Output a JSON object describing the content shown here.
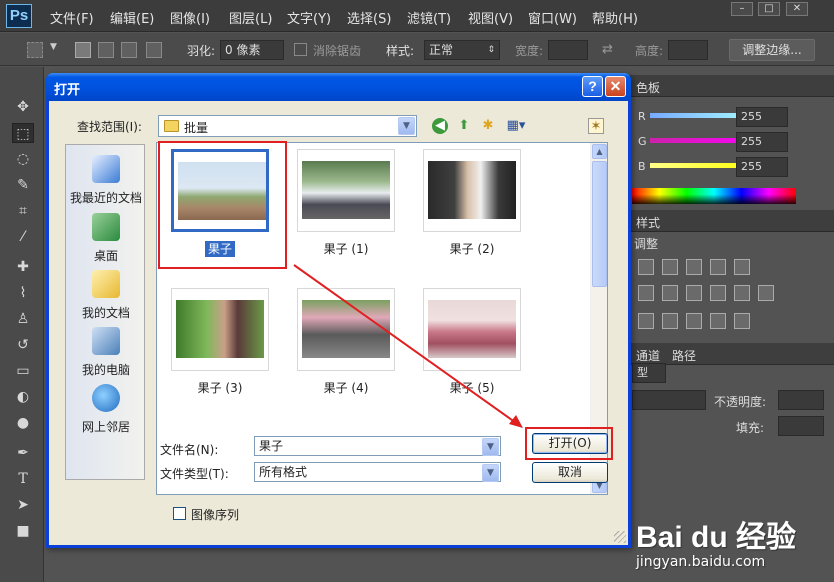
{
  "app": {
    "logo": "Ps",
    "menu": [
      "文件(F)",
      "编辑(E)",
      "图像(I)",
      "图层(L)",
      "文字(Y)",
      "选择(S)",
      "滤镜(T)",
      "视图(V)",
      "窗口(W)",
      "帮助(H)"
    ],
    "window_buttons": [
      "–",
      "□",
      "✕"
    ]
  },
  "options_bar": {
    "feather_label": "羽化:",
    "feather_value": "0 像素",
    "antialias_label": "消除锯齿",
    "style_label": "样式:",
    "style_value": "正常",
    "width_label": "宽度:",
    "height_label": "高度:",
    "refine_edge_label": "调整边缘..."
  },
  "right_panel": {
    "color_tab": "色板",
    "channels": [
      {
        "label": "R",
        "value": "255",
        "color": "#ff0000"
      },
      {
        "label": "G",
        "value": "255",
        "color": "#ff00ff"
      },
      {
        "label": "B",
        "value": "255",
        "color": "#ffff00"
      }
    ],
    "styles_tab": "样式",
    "adjust_label": "调整",
    "channel_tab": "通道",
    "paths_tab": "路径",
    "kind_label": "型",
    "opacity_label": "不透明度:",
    "fill_label": "填充:"
  },
  "dialog": {
    "title": "打开",
    "look_in_label": "查找范围(I):",
    "look_in_value": "批量",
    "places": [
      {
        "label": "我最近的文档",
        "icon": "recent-docs-icon",
        "color": "#3a7bd5"
      },
      {
        "label": "桌面",
        "icon": "desktop-icon",
        "color": "#2a8a3e"
      },
      {
        "label": "我的文档",
        "icon": "my-documents-icon",
        "color": "#e6b830"
      },
      {
        "label": "我的电脑",
        "icon": "my-computer-icon",
        "color": "#4a7fb8"
      },
      {
        "label": "网上邻居",
        "icon": "network-icon",
        "color": "#3f8fd8"
      }
    ],
    "files": [
      {
        "name": "果子",
        "selected": true
      },
      {
        "name": "果子 (1)",
        "selected": false
      },
      {
        "name": "果子 (2)",
        "selected": false
      },
      {
        "name": "果子 (3)",
        "selected": false
      },
      {
        "name": "果子 (4)",
        "selected": false
      },
      {
        "name": "果子 (5)",
        "selected": false
      }
    ],
    "filename_label": "文件名(N):",
    "filename_value": "果子",
    "filetype_label": "文件类型(T):",
    "filetype_value": "所有格式",
    "open_button": "打开(O)",
    "cancel_button": "取消",
    "image_sequence_label": "图像序列"
  },
  "watermark": {
    "logo": "Bai du 经验",
    "url": "jingyan.baidu.com"
  }
}
